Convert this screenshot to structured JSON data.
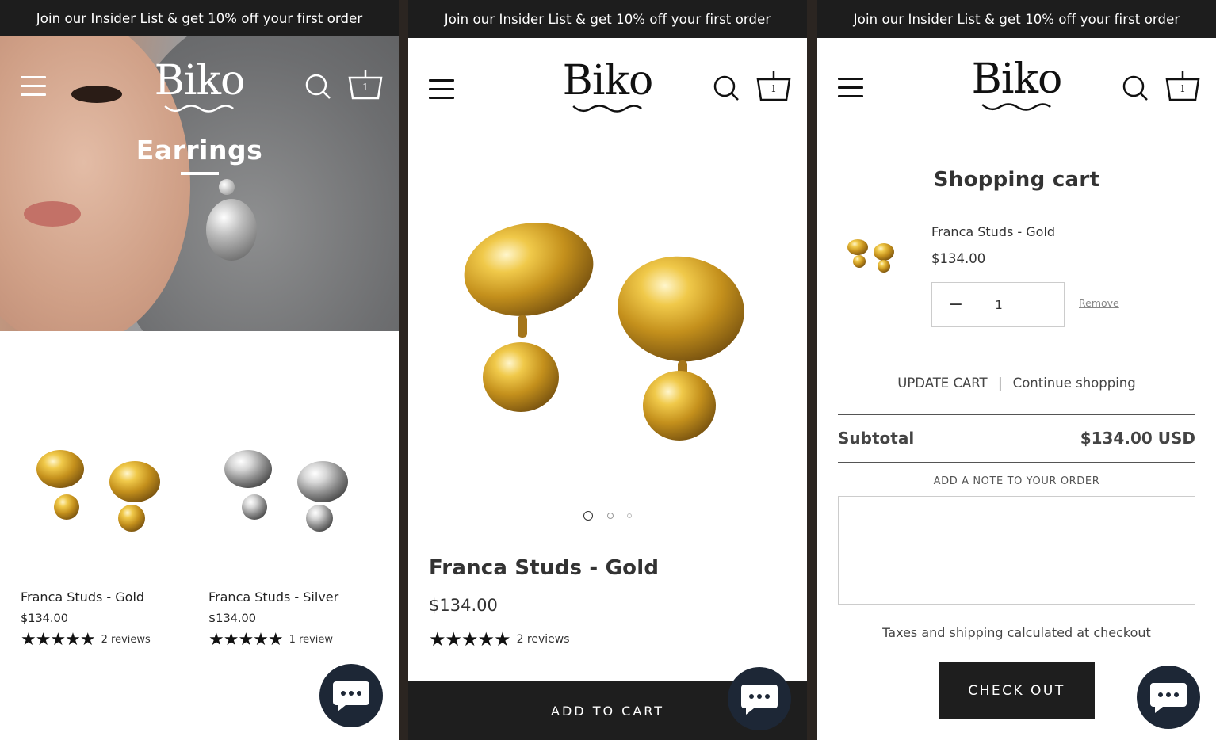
{
  "promo_text": "Join our Insider List & get 10% off your first order",
  "brand": {
    "logo_text": "Biko",
    "cart_count": "1"
  },
  "collection": {
    "hero_title": "Earrings",
    "products": [
      {
        "name": "Franca Studs - Gold",
        "price": "$134.00",
        "stars": "★★★★★",
        "reviews": "2 reviews",
        "metal": "gold"
      },
      {
        "name": "Franca Studs - Silver",
        "price": "$134.00",
        "stars": "★★★★★",
        "reviews": "1 review",
        "metal": "silver"
      }
    ]
  },
  "product": {
    "title": "Franca Studs - Gold",
    "price": "$134.00",
    "stars": "★★★★★",
    "reviews": "2 reviews",
    "gallery_slides": 3,
    "active_slide": 1,
    "add_to_cart_label": "ADD TO CART"
  },
  "cart": {
    "title": "Shopping cart",
    "item": {
      "name": "Franca Studs - Gold",
      "price": "$134.00",
      "quantity": "1",
      "minus_symbol": "−",
      "remove_label": "Remove"
    },
    "update_label": "UPDATE CART",
    "separator": "|",
    "continue_label": "Continue shopping",
    "subtotal_label": "Subtotal",
    "subtotal_value": "$134.00 USD",
    "note_label": "ADD A NOTE TO YOUR ORDER",
    "note_value": "",
    "tax_note": "Taxes and shipping calculated at checkout",
    "checkout_label": "CHECK OUT"
  },
  "colors": {
    "dark": "#1d1d1d",
    "gold": "#d4a72c",
    "silver": "#bfbfbf",
    "chat": "#1d2736"
  }
}
